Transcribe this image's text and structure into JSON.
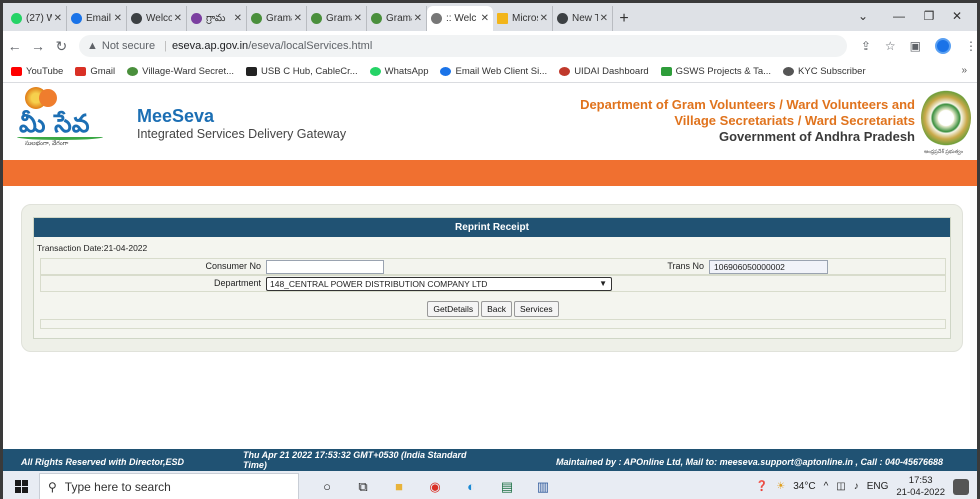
{
  "browser": {
    "tabs": [
      {
        "label": "(27) W",
        "color": "#25d366"
      },
      {
        "label": "Email",
        "color": "#1a73e8"
      },
      {
        "label": "Welco",
        "color": "#3c4043"
      },
      {
        "label": "గ్రామ",
        "color": "#7b3fa0"
      },
      {
        "label": "Grama",
        "color": "#4a8f3c"
      },
      {
        "label": "Grama",
        "color": "#4a8f3c"
      },
      {
        "label": "Grama",
        "color": "#4a8f3c"
      },
      {
        "label": ":: Welc",
        "color": "#777777",
        "active": true
      },
      {
        "label": "Micros",
        "color": "#f2b51a"
      },
      {
        "label": "New T",
        "color": "#3c4043"
      }
    ],
    "new_tab": "+",
    "address": {
      "security": "Not secure",
      "host": "eseva.ap.gov.in",
      "path": "/eseva/localServices.html"
    },
    "bookmarks": [
      {
        "label": "YouTube",
        "color": "#ff0000"
      },
      {
        "label": "Gmail",
        "color": "#d93025"
      },
      {
        "label": "Village-Ward Secret...",
        "color": "#4a8f3c"
      },
      {
        "label": "USB C Hub, CableCr...",
        "color": "#222222"
      },
      {
        "label": "WhatsApp",
        "color": "#25d366"
      },
      {
        "label": "Email Web Client Si...",
        "color": "#1a73e8"
      },
      {
        "label": "UIDAI Dashboard",
        "color": "#c0392b"
      },
      {
        "label": "GSWS Projects & Ta...",
        "color": "#2e9d3a"
      },
      {
        "label": "KYC Subscriber",
        "color": "#555555"
      }
    ],
    "bookmarks_more": "»"
  },
  "site": {
    "logo_text": "మీ సేవ",
    "logo_tagline": "సులభంగా, వేగంగా",
    "brand_name": "MeeSeva",
    "brand_sub": "Integrated Services Delivery Gateway",
    "dept_line1": "Department of Gram Volunteers / Ward Volunteers and",
    "dept_line2": "Village Secretariats / Ward Secretariats",
    "dept_line3": "Government of Andhra Pradesh",
    "emblem_label": "ఆంధ్రప్రదేశ్ ప్రభుత్వం"
  },
  "form": {
    "title": "Reprint Receipt",
    "transaction_date": "Transaction Date:21-04-2022",
    "consumer_label": "Consumer No",
    "consumer_value": "",
    "trans_label": "Trans No",
    "trans_value": "106906050000002",
    "department_label": "Department",
    "department_value": "148_CENTRAL POWER DISTRIBUTION COMPANY LTD",
    "buttons": {
      "get": "GetDetails",
      "back": "Back",
      "services": "Services"
    }
  },
  "footer": {
    "left": "All Rights Reserved with Director,ESD",
    "center": "Thu Apr 21 2022 17:53:32 GMT+0530 (India Standard Time)",
    "right": "Maintained by : APOnline Ltd, Mail to: meeseva.support@aptonline.in , Call : 040-45676688"
  },
  "taskbar": {
    "search_placeholder": "Type here to search",
    "weather": "34°C",
    "language": "ENG",
    "time": "17:53",
    "date": "21-04-2022"
  }
}
